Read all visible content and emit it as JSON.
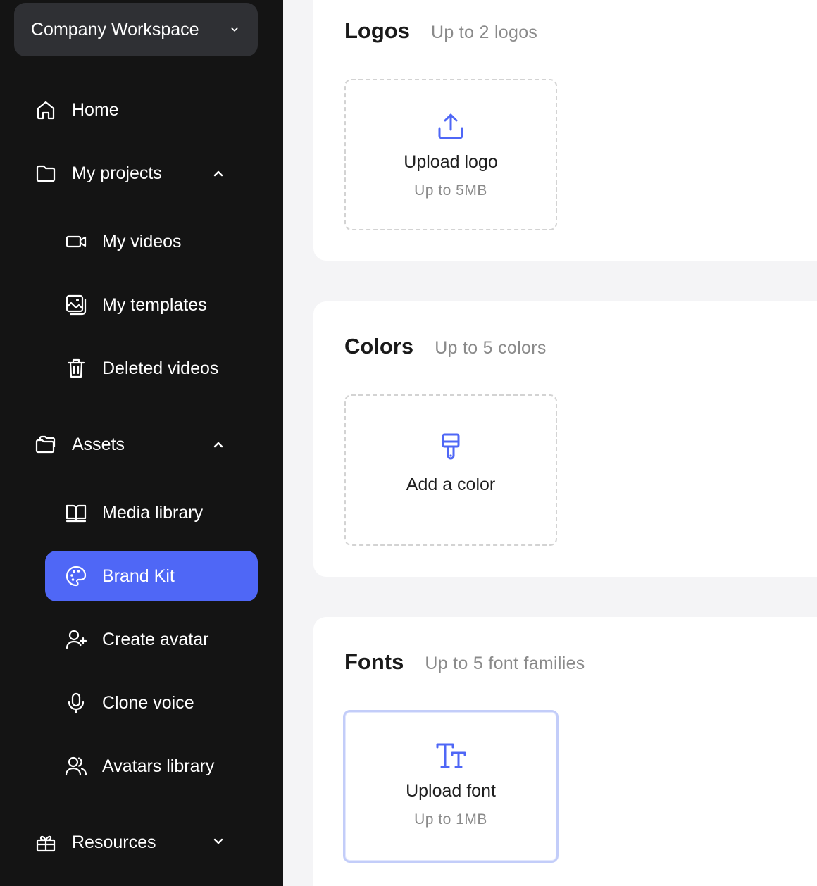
{
  "workspace": {
    "name": "Company Workspace",
    "icon": "chevron-down-icon"
  },
  "nav": {
    "home": {
      "label": "Home",
      "icon": "home-icon"
    },
    "projects": {
      "label": "My projects",
      "icon": "folder-icon",
      "expanded": true,
      "items": [
        {
          "label": "My videos",
          "icon": "video-camera-icon"
        },
        {
          "label": "My templates",
          "icon": "images-icon"
        },
        {
          "label": "Deleted videos",
          "icon": "trash-icon"
        }
      ]
    },
    "assets": {
      "label": "Assets",
      "icon": "assets-folder-icon",
      "expanded": true,
      "items": [
        {
          "label": "Media library",
          "icon": "book-icon"
        },
        {
          "label": "Brand Kit",
          "icon": "palette-icon",
          "active": true
        },
        {
          "label": "Create avatar",
          "icon": "user-plus-icon"
        },
        {
          "label": "Clone voice",
          "icon": "microphone-icon"
        },
        {
          "label": "Avatars library",
          "icon": "users-icon"
        }
      ]
    },
    "resources": {
      "label": "Resources",
      "icon": "gift-box-icon",
      "expanded": false
    }
  },
  "sections": {
    "logos": {
      "title": "Logos",
      "subtitle": "Up to 2 logos",
      "upload": {
        "label": "Upload logo",
        "hint": "Up to 5MB",
        "icon": "upload-icon"
      }
    },
    "colors": {
      "title": "Colors",
      "subtitle": "Up to 5 colors",
      "upload": {
        "label": "Add a color",
        "icon": "paint-brush-icon"
      }
    },
    "fonts": {
      "title": "Fonts",
      "subtitle": "Up to 5 font families",
      "upload": {
        "label": "Upload font",
        "hint": "Up to 1MB",
        "icon": "text-size-icon"
      }
    }
  },
  "colors": {
    "accent": "#4f67f6",
    "sidebar_bg": "#141414",
    "page_bg": "#f4f4f6"
  }
}
